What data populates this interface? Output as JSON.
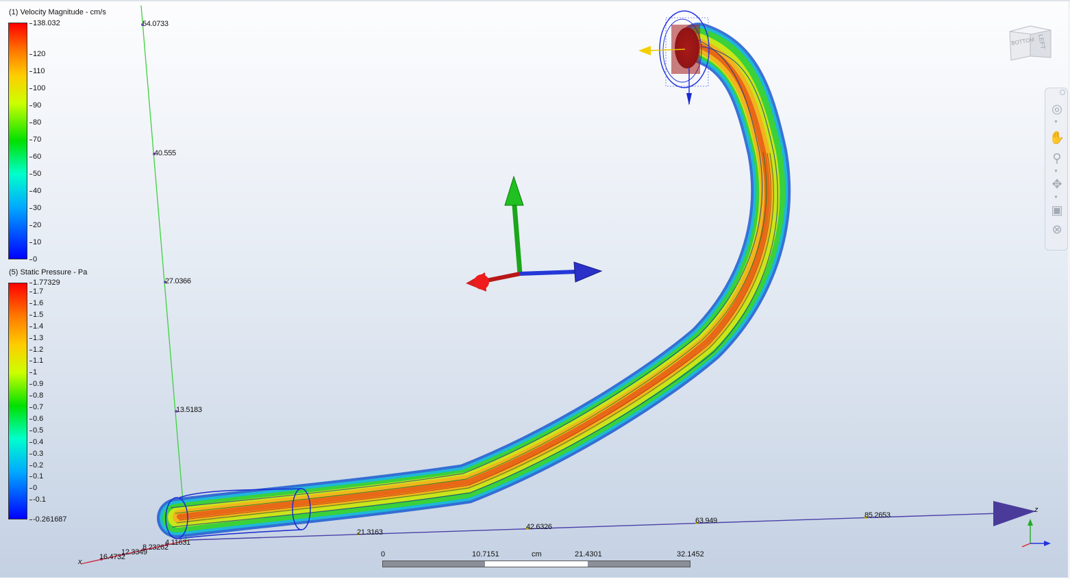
{
  "legends": [
    {
      "title": "(1) Velocity Magnitude - cm/s",
      "max_label": "138.032",
      "ticks": [
        "120",
        "110",
        "100",
        "90",
        "80",
        "70",
        "60",
        "50",
        "40",
        "30",
        "20",
        "10",
        "0"
      ]
    },
    {
      "title": "(5) Static Pressure - Pa",
      "max_label": "1.77329",
      "ticks": [
        "1.7",
        "1.6",
        "1.5",
        "1.4",
        "1.3",
        "1.2",
        "1.1",
        "1",
        "0.9",
        "0.8",
        "0.7",
        "0.6",
        "0.5",
        "0.4",
        "0.3",
        "0.2",
        "0.1",
        "0",
        "-0.1"
      ],
      "min_label": "-0.261687"
    }
  ],
  "axes": {
    "y_labels": [
      "54.0733",
      "40.555",
      "27.0366",
      "13.5183"
    ],
    "z_labels": [
      "21.3163",
      "42.6326",
      "63.949",
      "85.2653"
    ],
    "x_labels": [
      "4.11631",
      "8.23262",
      "12.3349",
      "16.4732"
    ],
    "x_name": "x",
    "z_name": "z"
  },
  "scale_bar": {
    "labels": [
      "0",
      "10.7151",
      "21.4301",
      "32.1452"
    ],
    "unit": "cm"
  },
  "view_cube": {
    "face_front": "LEFT",
    "face_bottom": "BOTTOM"
  },
  "nav_tools": [
    "steering-wheel",
    "pan",
    "zoom",
    "orbit",
    "look-at",
    "center"
  ],
  "colors": {
    "axis_green": "#22cc22",
    "axis_red": "#e02020",
    "axis_blue": "#1f3fd8",
    "axis_purple": "#3a2f8c"
  }
}
